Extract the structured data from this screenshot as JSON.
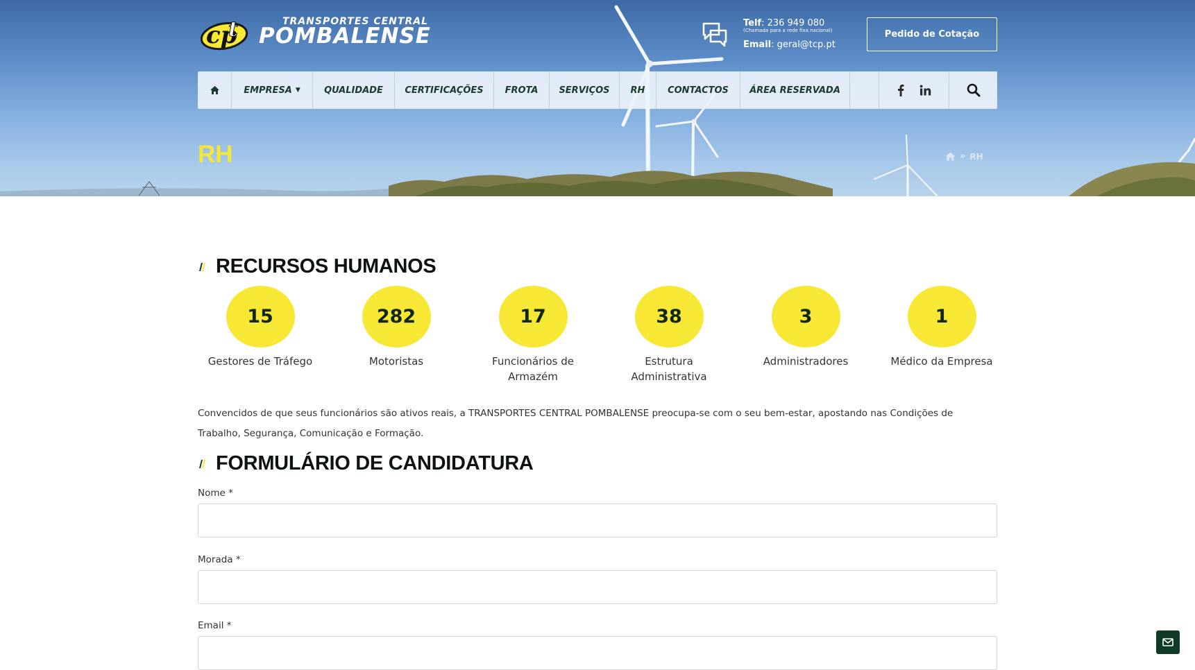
{
  "brand": {
    "name_top": "TRANSPORTES CENTRAL",
    "name_main": "POMBALENSE",
    "colors": {
      "yellow": "#f8e836",
      "dark_green": "#0f3a24",
      "sky": "#5d8dc8"
    }
  },
  "contact": {
    "tel_label": "Telf",
    "tel_value": ": 236 949 080",
    "tel_note": "(Chamada para a rede fixa nacional)",
    "email_label": "Email",
    "email_value": ": geral@tcp.pt",
    "icon": "chat-bubbles-icon"
  },
  "quote_button": "Pedido de Cotação",
  "nav": {
    "home_icon": "home-icon",
    "items": [
      {
        "label": "EMPRESA",
        "has_dropdown": true
      },
      {
        "label": "QUALIDADE"
      },
      {
        "label": "CERTIFICAÇÕES"
      },
      {
        "label": "FROTA"
      },
      {
        "label": "SERVIÇOS"
      },
      {
        "label": "RH"
      },
      {
        "label": "CONTACTOS"
      },
      {
        "label": "ÁREA RESERVADA"
      }
    ],
    "social": [
      "facebook-icon",
      "linkedin-icon"
    ],
    "search_icon": "search-icon"
  },
  "page": {
    "title": "RH",
    "breadcrumb_current": "RH"
  },
  "sections": {
    "hr_title": "RECURSOS HUMANOS",
    "form_title": "FORMULÁRIO DE CANDIDATURA"
  },
  "stats": [
    {
      "value": "15",
      "label": "Gestores de Tráfego"
    },
    {
      "value": "282",
      "label": "Motoristas"
    },
    {
      "value": "17",
      "label": "Funcionários de Armazém"
    },
    {
      "value": "38",
      "label": "Estrutura Administrativa"
    },
    {
      "value": "3",
      "label": "Administradores"
    },
    {
      "value": "1",
      "label": "Médico da Empresa"
    }
  ],
  "intro": "Convencidos de que seus funcionários são ativos reais, a TRANSPORTES CENTRAL POMBALENSE preocupa-se com o seu bem-estar, apostando nas Condições de Trabalho, Segurança, Comunicação e Formação.",
  "form": {
    "fields": [
      {
        "label": "Nome *",
        "value": ""
      },
      {
        "label": "Morada *",
        "value": ""
      },
      {
        "label": "Email *",
        "value": ""
      }
    ]
  },
  "floating": {
    "icon": "envelope-icon"
  }
}
